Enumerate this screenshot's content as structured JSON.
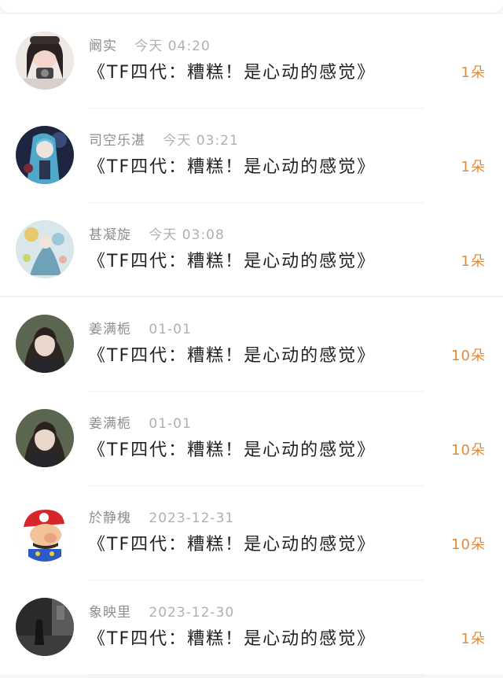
{
  "theme": {
    "background": "#f5f5f5",
    "card": "#ffffff",
    "name_color": "#8e8e8e",
    "time_color": "#b0b0b0",
    "title_color": "#222222",
    "count_color": "#e58a3a"
  },
  "items": [
    {
      "user": "阚实",
      "time": "今天 04:20",
      "title": "《TF四代：糟糕！是心动的感觉》",
      "count": "1朵",
      "avatar": "avatar-girl-camera-icon"
    },
    {
      "user": "司空乐湛",
      "time": "今天 03:21",
      "title": "《TF四代：糟糕！是心动的感觉》",
      "count": "1朵",
      "avatar": "avatar-anime-blue-hair-icon"
    },
    {
      "user": "甚凝旋",
      "time": "今天 03:08",
      "title": "《TF四代：糟糕！是心动的感觉》",
      "count": "1朵",
      "avatar": "avatar-anime-flower-icon"
    },
    {
      "user": "姜满栀",
      "time": "01-01",
      "title": "《TF四代：糟糕！是心动的感觉》",
      "count": "10朵",
      "avatar": "avatar-girl-photo-icon"
    },
    {
      "user": "姜满栀",
      "time": "01-01",
      "title": "《TF四代：糟糕！是心动的感觉》",
      "count": "10朵",
      "avatar": "avatar-girl-photo-icon"
    },
    {
      "user": "於静槐",
      "time": "2023-12-31",
      "title": "《TF四代：糟糕！是心动的感觉》",
      "count": "10朵",
      "avatar": "avatar-mario-icon"
    },
    {
      "user": "象映里",
      "time": "2023-12-30",
      "title": "《TF四代：糟糕！是心动的感觉》",
      "count": "1朵",
      "avatar": "avatar-dark-street-icon"
    }
  ]
}
